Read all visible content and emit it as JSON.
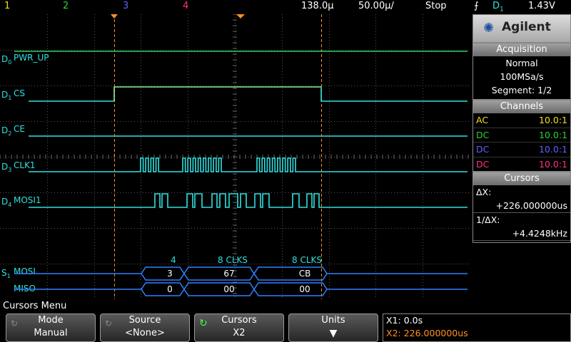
{
  "top_bar": {
    "channels": [
      "1",
      "2",
      "3",
      "4"
    ],
    "channel_colors": [
      "#f0e020",
      "#30d030",
      "#6060ff",
      "#ff3080"
    ],
    "time_per_div": "138.0µ",
    "delay": "50.00µ/",
    "run_state": "Stop",
    "trigger_icon": "trigger-edge-icon",
    "trigger_source": "D",
    "trigger_source_sub": "1",
    "trigger_level": "1.43V"
  },
  "digital": {
    "color": "#30e0e0",
    "channels": [
      {
        "prefix": "D",
        "sub": "0",
        "name": "PWR_UP"
      },
      {
        "prefix": "D",
        "sub": "1",
        "name": "CS"
      },
      {
        "prefix": "D",
        "sub": "2",
        "name": "CE"
      },
      {
        "prefix": "D",
        "sub": "3",
        "name": "CLK1"
      },
      {
        "prefix": "D",
        "sub": "4",
        "name": "MOSI1"
      }
    ]
  },
  "serial": {
    "prefix": "S",
    "sub": "1",
    "rows": [
      {
        "name": "MOSI",
        "packets": [
          "3",
          "67",
          "CB"
        ]
      },
      {
        "name": "MISO",
        "packets": [
          "0",
          "00",
          "00"
        ]
      }
    ],
    "clk_labels": [
      "4",
      "8  CLKS",
      "8  CLKS"
    ]
  },
  "right_panel": {
    "brand": "Agilent",
    "acquisition": {
      "title": "Acquisition",
      "mode": "Normal",
      "rate": "100MSa/s",
      "segment": "Segment: 1/2"
    },
    "channels": {
      "title": "Channels",
      "rows": [
        {
          "coupling": "AC",
          "ratio": "10.0:1",
          "color": "#f0e020"
        },
        {
          "coupling": "DC",
          "ratio": "10.0:1",
          "color": "#30d030"
        },
        {
          "coupling": "DC",
          "ratio": "10.0:1",
          "color": "#6060ff"
        },
        {
          "coupling": "DC",
          "ratio": "10.0:1",
          "color": "#ff3080"
        }
      ]
    },
    "cursors": {
      "title": "Cursors",
      "dx_label": "ΔX:",
      "dx_value": "+226.000000us",
      "inv_label": "1/ΔX:",
      "inv_value": "+4.4248kHz"
    }
  },
  "menu": {
    "title": "Cursors Menu",
    "keys": [
      {
        "label": "Mode",
        "value": "Manual"
      },
      {
        "label": "Source",
        "value": "<None>"
      },
      {
        "label": "Cursors",
        "value": "X2"
      },
      {
        "label": "Units",
        "value": ""
      }
    ],
    "x1": "X1: 0.0s",
    "x2": "X2: 226.000000us",
    "x1_color": "#ffffff",
    "x2_color": "#ff9020"
  }
}
